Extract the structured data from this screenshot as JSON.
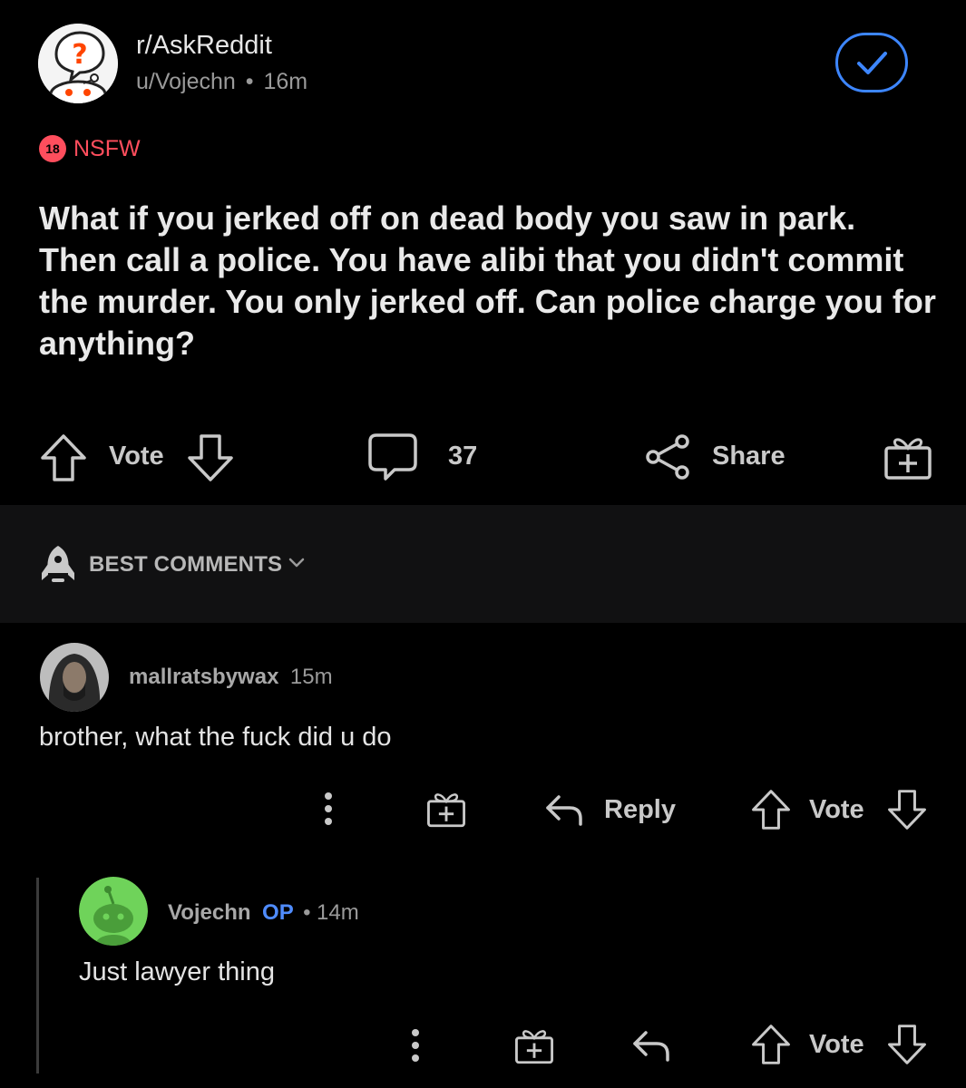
{
  "post": {
    "subreddit": "r/AskReddit",
    "author": "u/Vojechn",
    "separator": "•",
    "age": "16m",
    "nsfw_badge": "18",
    "nsfw_label": "NSFW",
    "title": "What if you jerked off on dead body you saw in park. Then call a police. You have alibi that you didn't commit the murder. You only jerked off. Can police charge you for anything?",
    "joined_icon": "checkmark-icon"
  },
  "actions": {
    "vote_label": "Vote",
    "comment_count": "37",
    "share_label": "Share",
    "icons": [
      "upvote-icon",
      "downvote-icon",
      "comment-bubble-icon",
      "share-icon",
      "award-icon"
    ]
  },
  "sort": {
    "label": "BEST COMMENTS",
    "icon": "rocket-icon"
  },
  "comments": [
    {
      "username": "mallratsbywax",
      "age": "15m",
      "body": "brother, what the fuck did u do",
      "reply_label": "Reply",
      "vote_label": "Vote"
    },
    {
      "username": "Vojechn",
      "op_label": "OP",
      "separator": "•",
      "age": "14m",
      "body": "Just lawyer thing",
      "vote_label": "Vote"
    }
  ],
  "colors": {
    "background": "#000000",
    "sort_bar": "#111112",
    "accent_blue": "#3d86ff",
    "nsfw_red": "#ff4e5d",
    "avatar_green": "#6fd35a"
  }
}
